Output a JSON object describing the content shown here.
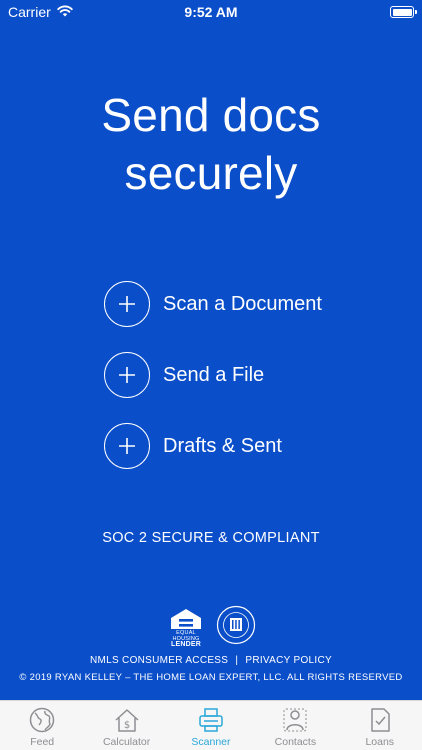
{
  "status_bar": {
    "carrier": "Carrier",
    "time": "9:52 AM"
  },
  "hero": {
    "line1": "Send docs",
    "line2": "securely"
  },
  "actions": [
    {
      "label": "Scan a Document",
      "icon": "plus-icon"
    },
    {
      "label": "Send a File",
      "icon": "plus-icon"
    },
    {
      "label": "Drafts & Sent",
      "icon": "plus-icon"
    }
  ],
  "security_note": "SOC 2 SECURE & COMPLIANT",
  "badges": {
    "ehl_line1": "EQUAL HOUSING",
    "ehl_line2": "LENDER"
  },
  "footer": {
    "nmls_link": "NMLS CONSUMER ACCESS",
    "separator": "|",
    "privacy_link": "PRIVACY POLICY",
    "copyright": "© 2019 RYAN KELLEY – THE HOME LOAN EXPERT, LLC. ALL RIGHTS RESERVED"
  },
  "tabs": [
    {
      "label": "Feed",
      "icon": "globe-icon",
      "active": false
    },
    {
      "label": "Calculator",
      "icon": "house-dollar-icon",
      "active": false
    },
    {
      "label": "Scanner",
      "icon": "scanner-icon",
      "active": true
    },
    {
      "label": "Contacts",
      "icon": "contact-card-icon",
      "active": false
    },
    {
      "label": "Loans",
      "icon": "document-check-icon",
      "active": false
    }
  ],
  "colors": {
    "background": "#0a4ec9",
    "tab_active": "#2aa7d9",
    "tab_inactive": "#8e8e93"
  }
}
